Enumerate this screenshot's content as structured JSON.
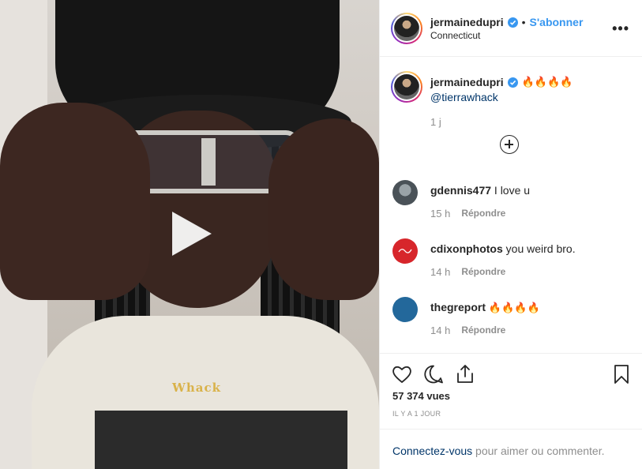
{
  "video": {
    "necklace_text": "Whack"
  },
  "header": {
    "username": "jermainedupri",
    "separator": "•",
    "follow_label": "S'abonner",
    "location": "Connecticut",
    "more_icon": "more-horizontal-icon"
  },
  "caption": {
    "username": "jermainedupri",
    "emojis": "🔥🔥🔥🔥",
    "mention": "@tierrawhack",
    "time": "1 j"
  },
  "comments": [
    {
      "username": "gdennis477",
      "text": "I love u",
      "time": "15 h",
      "reply": "Répondre",
      "avatar_color": "#6b7a86"
    },
    {
      "username": "cdixonphotos",
      "text": "you weird bro.",
      "time": "14 h",
      "reply": "Répondre",
      "avatar_color": "#d7262b"
    },
    {
      "username": "thegreport",
      "text": "🔥🔥🔥🔥",
      "time": "14 h",
      "reply": "Répondre",
      "avatar_color": "#23689b"
    }
  ],
  "actions": {
    "views": "57 374 vues",
    "posted": "IL Y A 1 JOUR"
  },
  "login": {
    "link": "Connectez-vous",
    "rest": " pour aimer ou commenter."
  },
  "colors": {
    "accent": "#3897f0",
    "link": "#003569",
    "muted": "#8e8e8e"
  }
}
